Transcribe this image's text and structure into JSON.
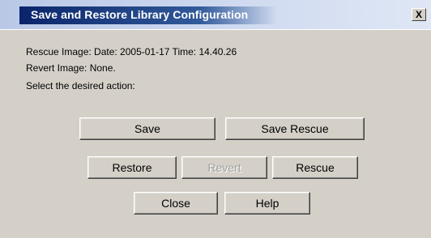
{
  "window": {
    "title": "Save and Restore Library Configuration",
    "close_glyph": "X"
  },
  "info": {
    "rescue_image": "Rescue Image: Date: 2005-01-17 Time: 14.40.26",
    "revert_image": "Revert Image: None.",
    "prompt": "Select the desired action:"
  },
  "buttons": {
    "save": "Save",
    "save_rescue": "Save Rescue",
    "restore": "Restore",
    "revert": "Revert",
    "rescue": "Rescue",
    "close": "Close",
    "help": "Help"
  },
  "colors": {
    "dialog_bg": "#d4d0c8",
    "title_bar": "#0a246a",
    "disabled_text": "#a0a0a0"
  },
  "icons": {
    "close": "close-icon"
  }
}
